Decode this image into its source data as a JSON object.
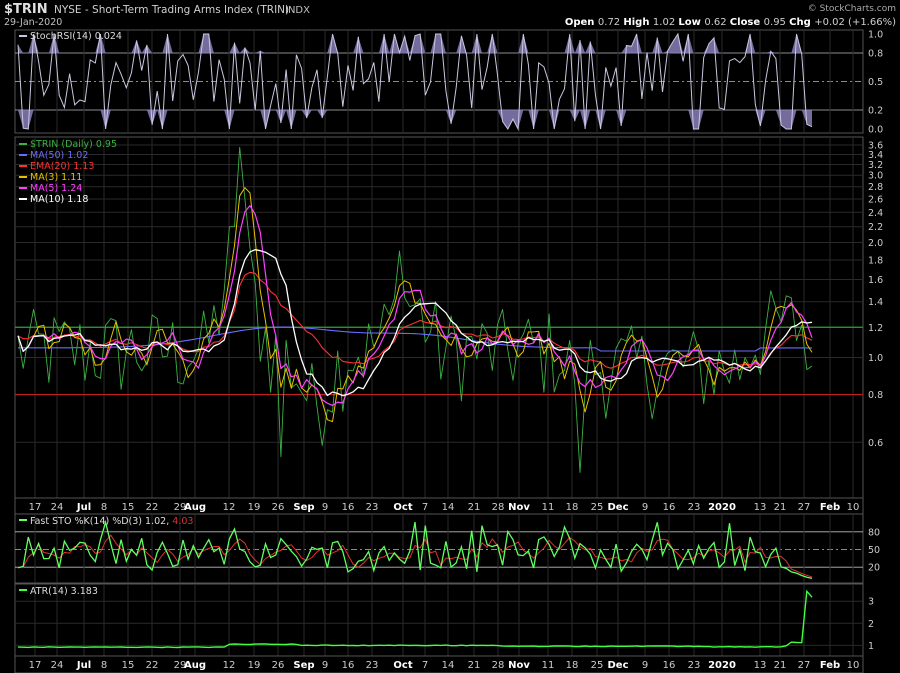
{
  "header": {
    "ticker": "$TRIN",
    "description": "NYSE - Short-Term Trading Arms Index (TRIN)",
    "exchange": "INDX",
    "date": "29-Jan-2020",
    "watermark": "© StockCharts.com",
    "quote": [
      {
        "label": "Open",
        "value": "0.72"
      },
      {
        "label": "High",
        "value": "1.02"
      },
      {
        "label": "Low",
        "value": "0.62"
      },
      {
        "label": "Close",
        "value": "0.95"
      },
      {
        "label": "Chg",
        "value": "+0.02 (+1.66%)"
      }
    ]
  },
  "colors": {
    "background": "#000000",
    "grid": "#2a2a2a",
    "frame": "#555555",
    "axis_text": "#cccccc",
    "stochrsi": "#c8c8e0",
    "stochrsi_fill": "#8a7fb8",
    "trin": "#3cb043",
    "ma50": "#6b6bff",
    "ema20": "#ff3030",
    "ma3": "#e8c000",
    "ma5": "#ff40ff",
    "ma10": "#ffffff",
    "sto_k": "#60ff60",
    "sto_d": "#e03030",
    "atr": "#40ff40",
    "refline_green": "#2fa02f",
    "refline_red": "#c02020"
  },
  "chart_data": [
    {
      "id": "stochrsi",
      "type": "line",
      "label": "StochRSI(14) 0.024",
      "yticks": [
        "1.0",
        "0.8",
        "0.5",
        "0.2",
        "0.0"
      ],
      "ylim": [
        0,
        1
      ],
      "reference_lines": [
        0.8,
        0.5,
        0.2
      ]
    },
    {
      "id": "price",
      "type": "line",
      "scale": "log",
      "yticks": [
        "3.6",
        "3.4",
        "3.2",
        "3.0",
        "2.8",
        "2.6",
        "2.4",
        "2.2",
        "2.0",
        "1.8",
        "1.6",
        "1.4",
        "1.2",
        "1.0",
        "0.8",
        "0.6"
      ],
      "ylim": [
        0.45,
        3.6
      ],
      "reference_lines": [
        {
          "value": 1.2,
          "color": "green"
        },
        {
          "value": 0.8,
          "color": "red"
        }
      ],
      "legend": [
        {
          "name": "$TRIN (Daily)",
          "value": "0.95",
          "color": "trin"
        },
        {
          "name": "MA(50)",
          "value": "1.02",
          "color": "ma50"
        },
        {
          "name": "EMA(20)",
          "value": "1.13",
          "color": "ema20"
        },
        {
          "name": "MA(3)",
          "value": "1.11",
          "color": "ma3"
        },
        {
          "name": "MA(5)",
          "value": "1.24",
          "color": "ma5"
        },
        {
          "name": "MA(10)",
          "value": "1.18",
          "color": "ma10"
        }
      ]
    },
    {
      "id": "faststo",
      "type": "line",
      "label_prefix": "Fast STO %K(14) %D(3)",
      "label_k": "1.02",
      "label_d": "4.03",
      "yticks": [
        "80",
        "50",
        "20"
      ],
      "ylim": [
        0,
        100
      ],
      "reference_lines": [
        80,
        50,
        20
      ]
    },
    {
      "id": "atr",
      "type": "line",
      "label": "ATR(14) 3.183",
      "yticks": [
        "3",
        "2",
        "1"
      ],
      "ylim": [
        0.7,
        3.6
      ]
    }
  ],
  "x_axis": {
    "ticks": [
      {
        "label": "17",
        "bold": false
      },
      {
        "label": "24",
        "bold": false
      },
      {
        "label": "Jul",
        "bold": true
      },
      {
        "label": "8",
        "bold": false
      },
      {
        "label": "15",
        "bold": false
      },
      {
        "label": "22",
        "bold": false
      },
      {
        "label": "29",
        "bold": false
      },
      {
        "label": "Aug",
        "bold": true
      },
      {
        "label": "12",
        "bold": false
      },
      {
        "label": "19",
        "bold": false
      },
      {
        "label": "26",
        "bold": false
      },
      {
        "label": "Sep",
        "bold": true
      },
      {
        "label": "9",
        "bold": false
      },
      {
        "label": "16",
        "bold": false
      },
      {
        "label": "23",
        "bold": false
      },
      {
        "label": "Oct",
        "bold": true
      },
      {
        "label": "7",
        "bold": false
      },
      {
        "label": "14",
        "bold": false
      },
      {
        "label": "21",
        "bold": false
      },
      {
        "label": "28",
        "bold": false
      },
      {
        "label": "Nov",
        "bold": true
      },
      {
        "label": "11",
        "bold": false
      },
      {
        "label": "18",
        "bold": false
      },
      {
        "label": "25",
        "bold": false
      },
      {
        "label": "Dec",
        "bold": true
      },
      {
        "label": "9",
        "bold": false
      },
      {
        "label": "16",
        "bold": false
      },
      {
        "label": "23",
        "bold": false
      },
      {
        "label": "2020",
        "bold": true
      },
      {
        "label": "13",
        "bold": false
      },
      {
        "label": "21",
        "bold": false
      },
      {
        "label": "27",
        "bold": false
      },
      {
        "label": "Feb",
        "bold": true
      },
      {
        "label": "10",
        "bold": false
      }
    ]
  }
}
